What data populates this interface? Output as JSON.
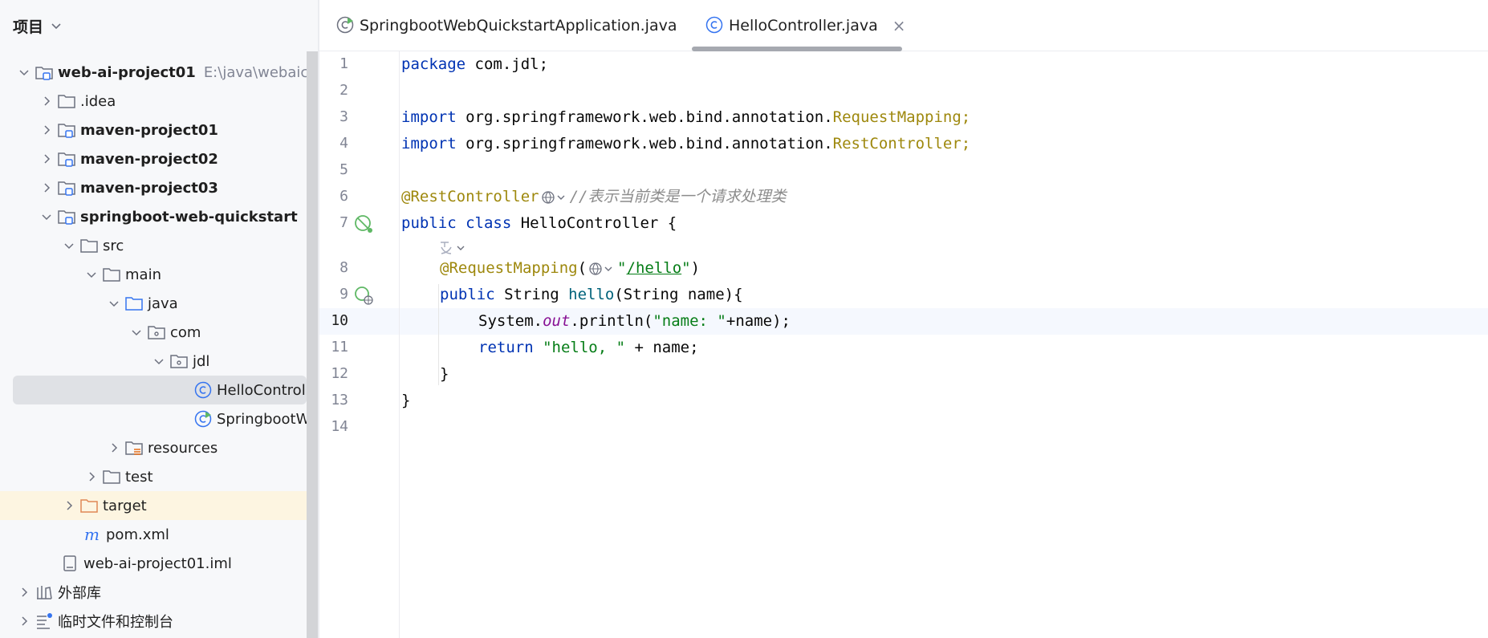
{
  "project_panel": {
    "title": "项目",
    "tree": [
      {
        "label": "web-ai-project01",
        "hint": "E:\\java\\webaicode\\",
        "bold": true
      },
      {
        "label": ".idea"
      },
      {
        "label": "maven-project01",
        "bold": true
      },
      {
        "label": "maven-project02",
        "bold": true
      },
      {
        "label": "maven-project03",
        "bold": true
      },
      {
        "label": "springboot-web-quickstart",
        "bold": true
      },
      {
        "label": "src"
      },
      {
        "label": "main"
      },
      {
        "label": "java"
      },
      {
        "label": "com"
      },
      {
        "label": "jdl"
      },
      {
        "label": "HelloController"
      },
      {
        "label": "SpringbootWebQuickstartApplication"
      },
      {
        "label": "resources"
      },
      {
        "label": "test"
      },
      {
        "label": "target"
      },
      {
        "label": "pom.xml"
      },
      {
        "label": "web-ai-project01.iml"
      },
      {
        "label": "外部库"
      },
      {
        "label": "临时文件和控制台"
      }
    ]
  },
  "tabs": [
    {
      "label": "SpringbootWebQuickstartApplication.java"
    },
    {
      "label": "HelloController.java",
      "close": "×"
    }
  ],
  "code": {
    "line_numbers": [
      "1",
      "2",
      "3",
      "4",
      "5",
      "6",
      "7",
      "8",
      "9",
      "10",
      "11",
      "12",
      "13",
      "14"
    ],
    "l1": {
      "kw": "package",
      "rest": " com.jdl;"
    },
    "l3": {
      "kw": "import",
      "pkg": " org.springframework.web.bind.annotation.",
      "cls": "RequestMapping",
      "semi": ";"
    },
    "l4": {
      "kw": "import",
      "pkg": " org.springframework.web.bind.annotation.",
      "cls": "RestController",
      "semi": ";"
    },
    "l6": {
      "ann": "@RestController",
      "cmt": "//表示当前类是一个请求处理类"
    },
    "l7": {
      "kw1": "public",
      "kw2": "class",
      "rest": " HelloController {"
    },
    "l8": {
      "ann": "@RequestMapping",
      "open": "(",
      "q1": "\"",
      "url": "/hello",
      "q2": "\"",
      "close": ")"
    },
    "l9": {
      "kw": "public",
      "type": " String ",
      "fn": "hello",
      "rest": "(String name){"
    },
    "l10": {
      "obj": "System.",
      "field": "out",
      "call": ".println(",
      "str": "\"name: \"",
      "rest": "+name);"
    },
    "l11": {
      "kw": "return",
      "sp": " ",
      "str": "\"hello, \"",
      "rest": " + name;"
    },
    "l12": {
      "brace": "}"
    },
    "l13": {
      "brace": "}"
    }
  },
  "colors": {
    "keyword": "#0033b3",
    "annotation": "#9e880d",
    "string": "#067d17",
    "comment": "#8c8c8c",
    "accent": "#3574f0"
  }
}
